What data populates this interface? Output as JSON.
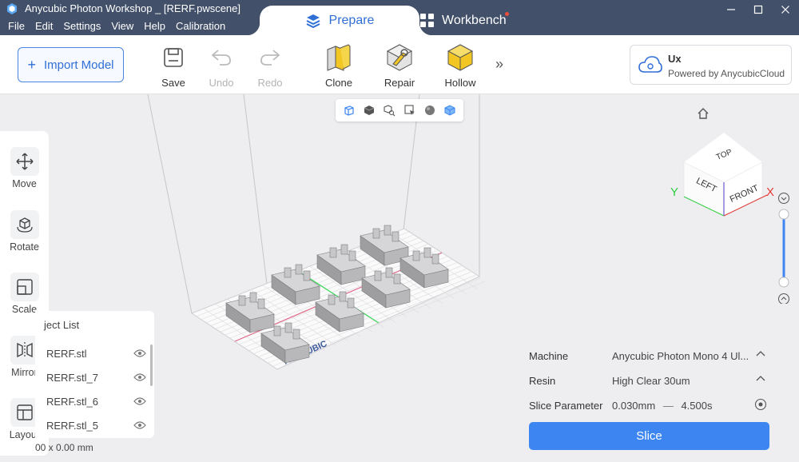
{
  "window": {
    "title": "Anycubic Photon Workshop _ [RERF.pwscene]",
    "menu": [
      "File",
      "Edit",
      "Settings",
      "View",
      "Help",
      "Calibration"
    ]
  },
  "tabs": {
    "prepare": "Prepare",
    "workbench": "Workbench"
  },
  "toolbar": {
    "import_label": "Import Model",
    "save": "Save",
    "undo": "Undo",
    "redo": "Redo",
    "clone": "Clone",
    "repair": "Repair",
    "hollow": "Hollow",
    "more": "»"
  },
  "cloud": {
    "user": "Ux",
    "subtitle": "Powered by AnycubicCloud"
  },
  "left_tools": [
    "Move",
    "Rotate",
    "Scale",
    "Mirror",
    "Layout"
  ],
  "object_list": {
    "title": "ject List",
    "items": [
      "RERF.stl",
      "RERF.stl_7",
      "RERF.stl_6",
      "RERF.stl_5"
    ]
  },
  "dimensions": "00 x 0.00 mm",
  "plate_logo": "ANYCUBIC",
  "view_cube": {
    "top": "TOP",
    "left": "LEFT",
    "front": "FRONT",
    "axis_x": "X",
    "axis_y": "Y"
  },
  "slice": {
    "machine_label": "Machine",
    "machine_value": "Anycubic Photon Mono 4 Ul...",
    "resin_label": "Resin",
    "resin_value": "High Clear 30um",
    "param_label": "Slice Parameter",
    "layer_height": "0.030mm",
    "separator": "—",
    "exposure": "4.500s",
    "button": "Slice"
  },
  "colors": {
    "titlebar": "#42506a",
    "accent": "#3d86f2",
    "axis_x": "#e53935",
    "axis_y": "#2ecc40",
    "axis_z": "#6a5acd"
  }
}
